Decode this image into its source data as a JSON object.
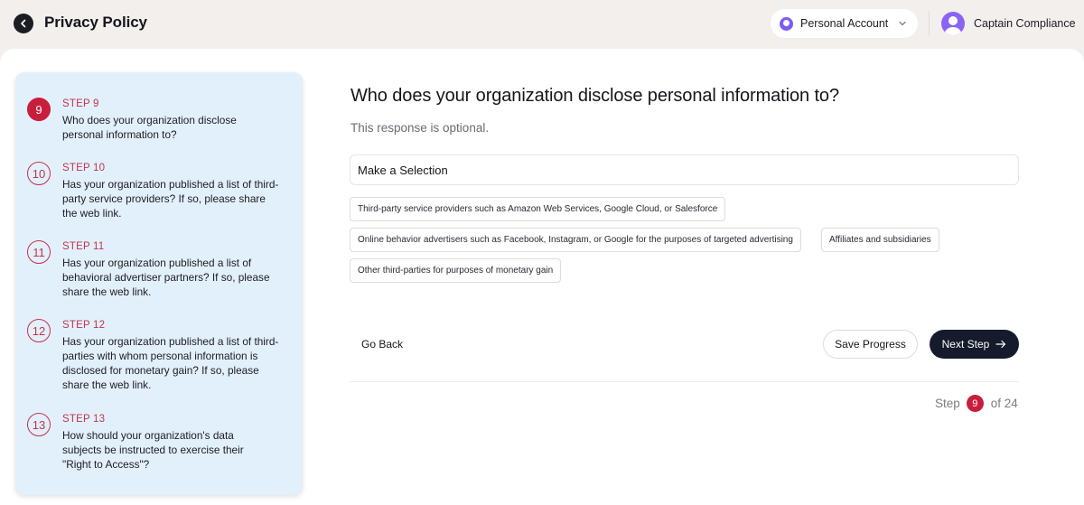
{
  "header": {
    "title": "Privacy Policy",
    "account_label": "Personal Account",
    "user_name": "Captain Compliance"
  },
  "steps": [
    {
      "label": "STEP 9",
      "number": "9",
      "text": "Who does your organization disclose personal information to?",
      "active": true
    },
    {
      "label": "STEP 10",
      "number": "10",
      "text": "Has your organization published a list of third-party service providers? If so, please share the web link."
    },
    {
      "label": "STEP 11",
      "number": "11",
      "text": "Has your organization published a list of behavioral advertiser partners? If so, please share the web link."
    },
    {
      "label": "STEP 12",
      "number": "12",
      "text": "Has your organization published a list of third-parties with whom personal information is disclosed for monetary gain? If so, please share the web link."
    },
    {
      "label": "STEP 13",
      "number": "13",
      "text": "How should your organization's data subjects be instructed to exercise their \"Right to Access\"?"
    }
  ],
  "question": {
    "title": "Who does your organization disclose personal information to?",
    "note": "This response is optional.",
    "selection_label": "Make a Selection",
    "options": [
      "Third-party service providers such as Amazon Web Services, Google Cloud, or Salesforce",
      "Online behavior advertisers such as Facebook, Instagram, or Google for the purposes of targeted advertising",
      "Affiliates and subsidiaries",
      "Other third-parties for purposes of monetary gain"
    ]
  },
  "actions": {
    "go_back": "Go Back",
    "save_progress": "Save Progress",
    "next_step": "Next Step"
  },
  "progress": {
    "prefix": "Step",
    "current": "9",
    "suffix": "of 24"
  },
  "colors": {
    "accent": "#c81e3c",
    "primary_button": "#151b2c",
    "steps_panel_bg": "#e2f0fc",
    "account_icon": "#7b5cf5"
  }
}
